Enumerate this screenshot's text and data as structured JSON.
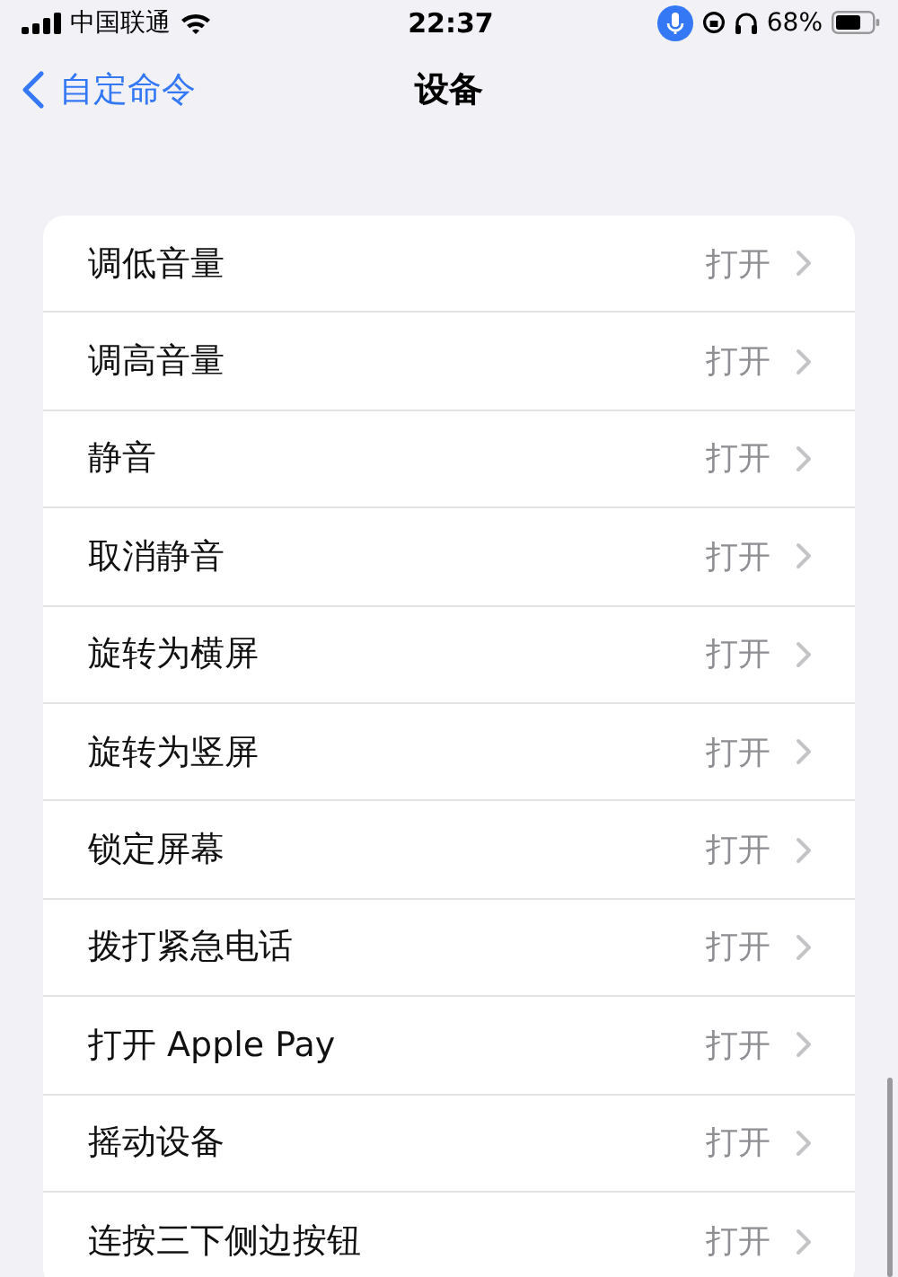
{
  "status_bar": {
    "carrier": "中国联通",
    "time": "22:37",
    "battery": "68%"
  },
  "nav": {
    "back": "自定命令",
    "title": "设备"
  },
  "rows": [
    {
      "label": "调低音量",
      "value": "打开"
    },
    {
      "label": "调高音量",
      "value": "打开"
    },
    {
      "label": "静音",
      "value": "打开"
    },
    {
      "label": "取消静音",
      "value": "打开"
    },
    {
      "label": "旋转为横屏",
      "value": "打开"
    },
    {
      "label": "旋转为竖屏",
      "value": "打开"
    },
    {
      "label": "锁定屏幕",
      "value": "打开"
    },
    {
      "label": "拨打紧急电话",
      "value": "打开"
    },
    {
      "label": "打开 Apple Pay",
      "value": "打开"
    },
    {
      "label": "摇动设备",
      "value": "打开"
    },
    {
      "label": "连按三下侧边按钮",
      "value": "打开"
    }
  ]
}
